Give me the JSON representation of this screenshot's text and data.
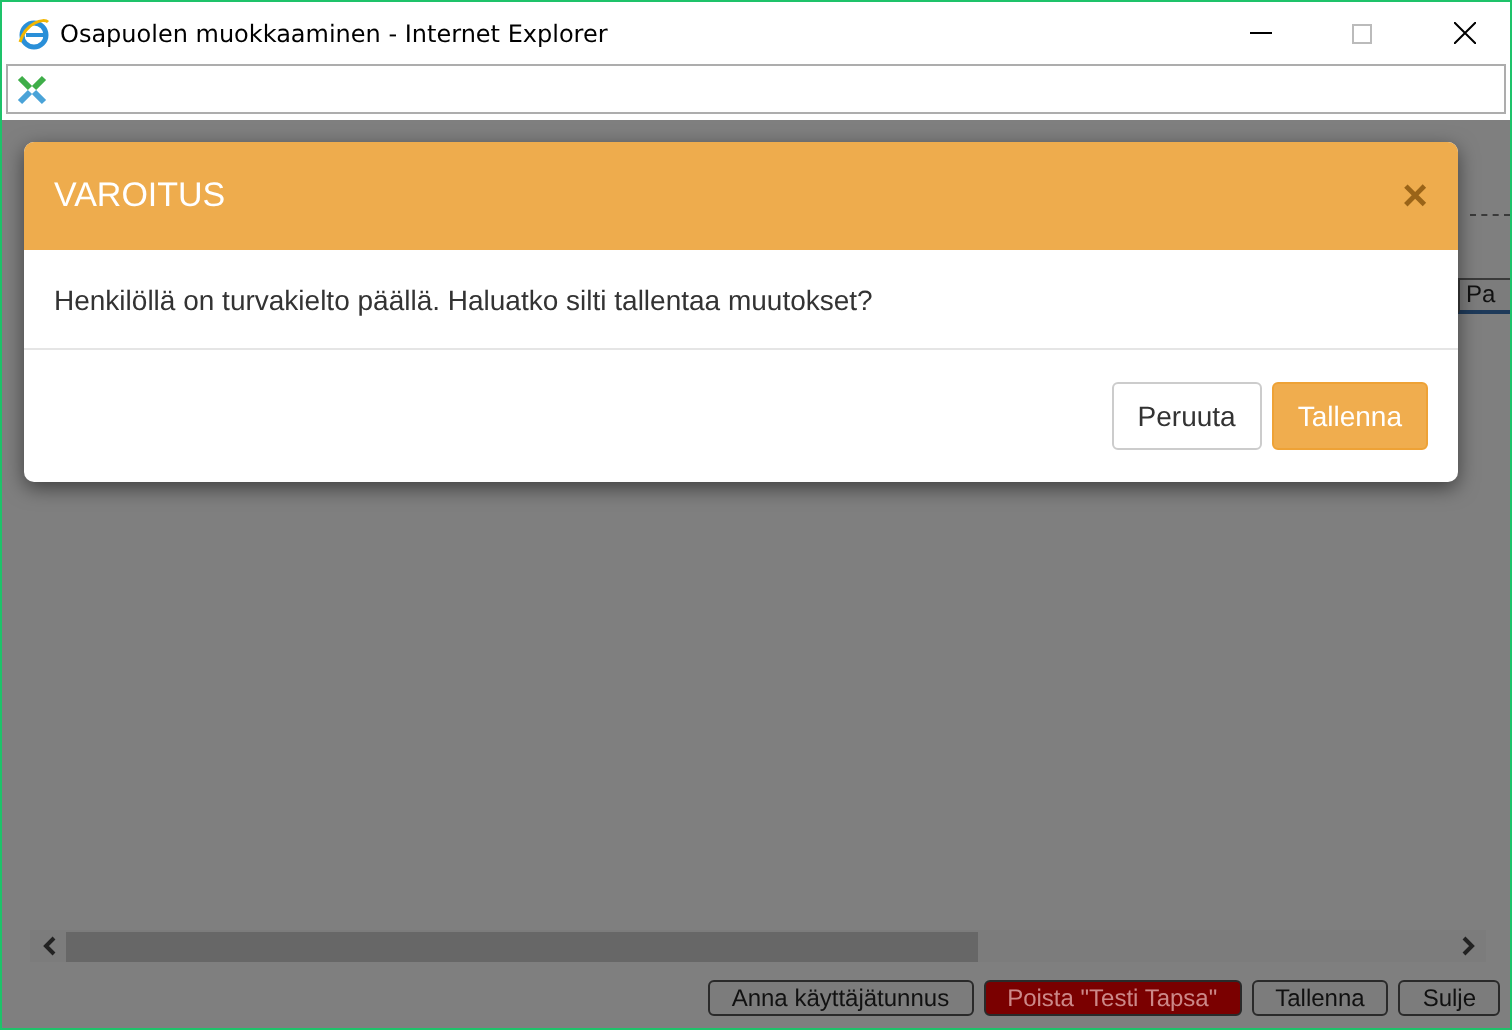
{
  "window": {
    "title": "Osapuolen muokkaaminen - Internet Explorer"
  },
  "page": {
    "partial_button": "Pa",
    "buttons": [
      {
        "label": "Anna käyttäjätunnus",
        "kind": "normal"
      },
      {
        "label": "Poista \"Testi Tapsa\"",
        "kind": "danger"
      },
      {
        "label": "Tallenna",
        "kind": "normal"
      },
      {
        "label": "Sulje",
        "kind": "normal"
      }
    ]
  },
  "dialog": {
    "title": "VAROITUS",
    "close": "×",
    "message": "Henkilöllä on turvakielto päällä. Haluatko silti tallentaa muutokset?",
    "buttons": [
      {
        "label": "Peruuta",
        "kind": "default"
      },
      {
        "label": "Tallenna",
        "kind": "primary"
      }
    ]
  }
}
